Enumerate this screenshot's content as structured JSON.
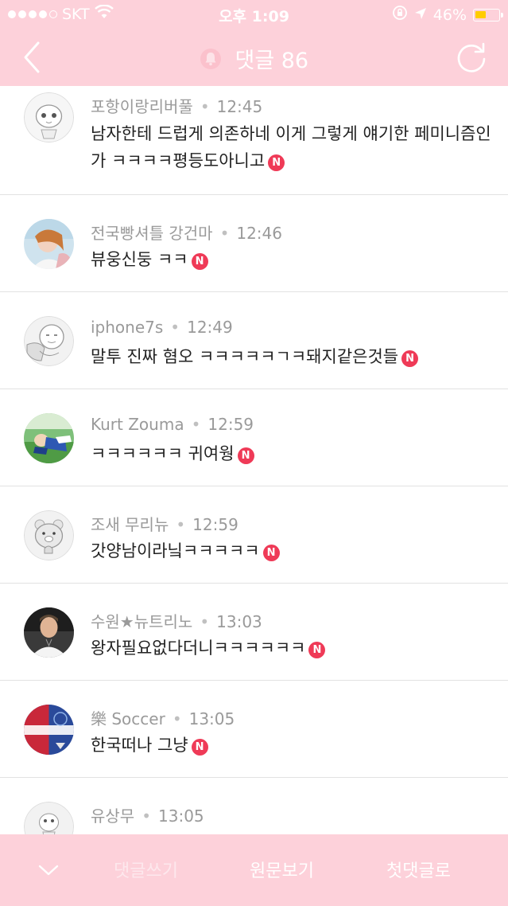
{
  "status_bar": {
    "carrier": "SKT",
    "signal_dots": 5,
    "signal_filled": 4,
    "time": "오후 1:09",
    "battery_text": "46%",
    "battery_level": 0.46,
    "battery_color": "#ffcc00"
  },
  "header": {
    "title": "댓글 86",
    "background": "#fdd1da"
  },
  "comments": [
    {
      "author": "포항이랑리버풀",
      "time": "12:45",
      "text": "남자한테 드럽게 의존하네 이게 그렇게 얘기한 페미니즘인가 ㅋㅋㅋㅋ평등도아니고",
      "new": "N",
      "avatar": "character-avatar"
    },
    {
      "author": "전국빵셔틀 강건마",
      "time": "12:46",
      "text": "뷰웅신둥 ㅋㅋ",
      "new": "N",
      "avatar": "photo-avatar"
    },
    {
      "author": "iphone7s",
      "time": "12:49",
      "text": "말투 진짜 혐오 ㅋㅋㅋㅋㅋㄱㅋ돼지같은것들",
      "new": "N",
      "avatar": "character-avatar"
    },
    {
      "author": "Kurt Zouma",
      "time": "12:59",
      "text": "ㅋㅋㅋㅋㅋㅋ 귀여웡",
      "new": "N",
      "avatar": "photo-avatar"
    },
    {
      "author": "조새 무리뉴",
      "time": "12:59",
      "text": "갓양남이라닠ㅋㅋㅋㅋㅋ",
      "new": "N",
      "avatar": "character-avatar"
    },
    {
      "author": "수원★뉴트리노",
      "time": "13:03",
      "text": "왕자필요없다더니ㅋㅋㅋㅋㅋㅋ",
      "new": "N",
      "avatar": "photo-avatar"
    },
    {
      "author": "樂 Soccer",
      "time": "13:05",
      "text": "한국떠나 그냥",
      "new": "N",
      "avatar": "soccer-logo-avatar"
    },
    {
      "author": "유상무",
      "time": "13:05",
      "text": "",
      "new": "",
      "avatar": "character-avatar"
    }
  ],
  "bottom_bar": {
    "write_label": "댓글쓰기",
    "original_label": "원문보기",
    "first_label": "첫댓글로"
  },
  "colors": {
    "accent_pink": "#fdd1da",
    "new_badge": "#ef3a57",
    "meta_text": "#9a9a9a"
  }
}
